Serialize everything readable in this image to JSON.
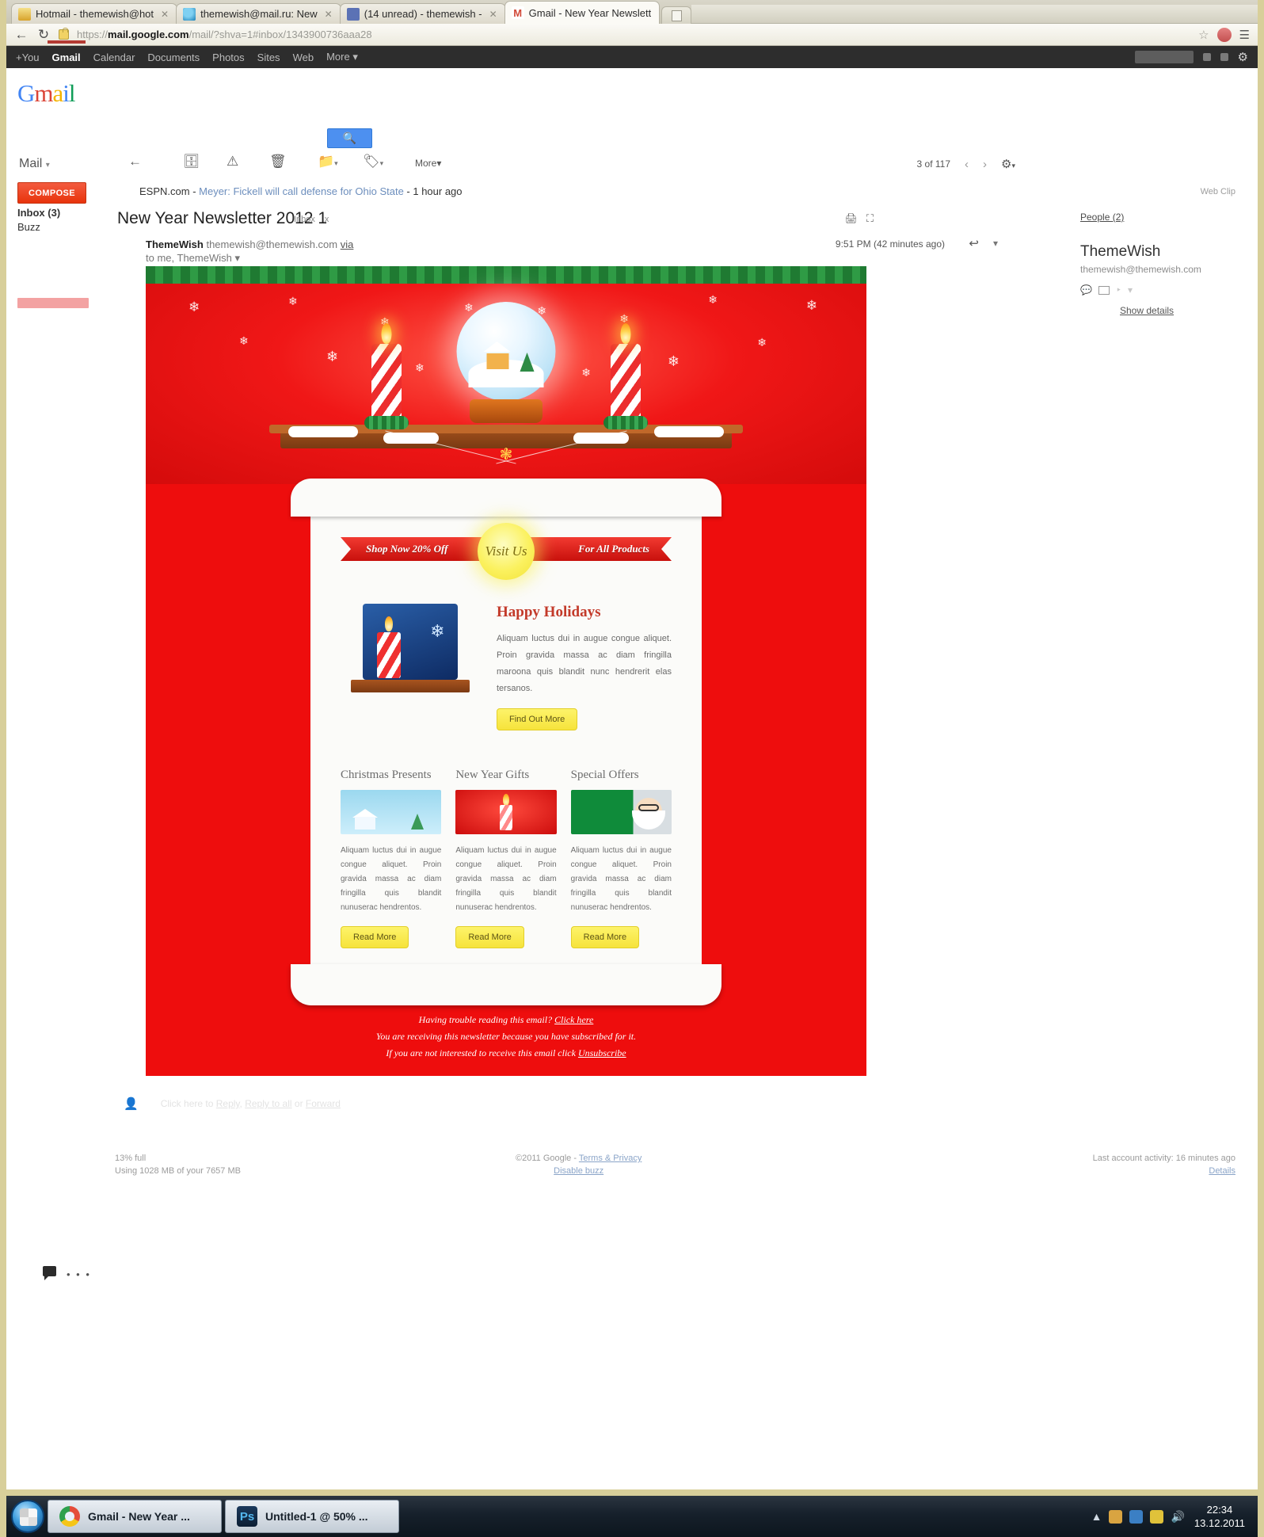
{
  "browser": {
    "tabs": [
      {
        "title": "Hotmail - themewish@hot",
        "favicon": "hotmail-icon",
        "active": false
      },
      {
        "title": "themewish@mail.ru: New",
        "favicon": "mailru-icon",
        "active": false
      },
      {
        "title": "(14 unread) - themewish -",
        "favicon": "facebook-icon",
        "active": false
      },
      {
        "title": "Gmail - New Year Newslett",
        "favicon": "gmail-icon",
        "active": true
      }
    ],
    "new_tab_label": "+",
    "back_icon": "back-arrow-icon",
    "reload_icon": "reload-icon",
    "lock_icon": "ssl-lock-icon",
    "url_scheme": "https://",
    "url_host": "mail.google.com",
    "url_path": "/mail/?shva=1#inbox/1343900736aaa28",
    "star_icon": "star-icon",
    "wrench_icon": "wrench-menu-icon"
  },
  "gbar": {
    "items": [
      "+You",
      "Gmail",
      "Calendar",
      "Documents",
      "Photos",
      "Sites",
      "Web",
      "More"
    ],
    "active": "Gmail",
    "more_caret": "▾",
    "gear_icon": "settings-gear-icon"
  },
  "gmail": {
    "logo": {
      "g": "G",
      "m": "m",
      "a": "a",
      "i": "i",
      "l": "l"
    },
    "mail_selector": "Mail",
    "mail_selector_caret": "▾",
    "compose_label": "COMPOSE",
    "nav": [
      {
        "label": "Inbox (3)",
        "bold": true
      },
      {
        "label": "Buzz",
        "bold": false
      }
    ],
    "search_icon": "search-magnifier-icon",
    "toolbar": {
      "back_icon": "back-to-inbox-icon",
      "archive_icon": "archive-icon",
      "spam_icon": "report-spam-icon",
      "delete_icon": "trash-delete-icon",
      "move_icon": "move-to-folder-icon",
      "label_icon": "labels-tag-icon",
      "more_label": "More",
      "caret": "▾"
    },
    "pager": {
      "text": "3 of 117",
      "prev_icon": "previous-arrow-icon",
      "next_icon": "next-arrow-icon",
      "gear_icon": "settings-gear-icon"
    },
    "web_clip_label": "Web Clip",
    "ad_strip": {
      "source": "ESPN.com",
      "headline": "Meyer: Fickell will call defense for Ohio State",
      "time": "1 hour ago"
    },
    "subject": "New Year Newsletter 2012 1",
    "subject_tags": [
      "Inbox",
      "x"
    ],
    "print_icon": "print-icon",
    "popout_icon": "open-in-new-window-icon",
    "sender": {
      "name": "ThemeWish",
      "email": "themewish@themewish.com",
      "via": "via",
      "recipients": "to me, ThemeWish",
      "caret": "▾"
    },
    "message_time": "9:51 PM (42 minutes ago)",
    "reply_icon": "reply-arrow-icon",
    "more_options_icon": "more-options-caret-icon",
    "people_panel": {
      "title": "People (2)",
      "contact_name": "ThemeWish",
      "contact_email": "themewish@themewish.com",
      "chat_icon": "chat-bubble-icon",
      "video_icon": "video-call-icon",
      "show_details": "Show details"
    },
    "reply_prompt": {
      "person_icon": "person-icon",
      "text": "Click here to",
      "reply": "Reply",
      "reply_all": "Reply to all",
      "forward": "Forward"
    },
    "footer": {
      "storage_percent": "13% full",
      "storage_usage": "Using 1028 MB of your 7657 MB",
      "copyright": "©2011 Google -",
      "terms": "Terms & Privacy",
      "disable_buzz": "Disable buzz",
      "last_activity": "Last account activity: 16 minutes ago",
      "details": "Details"
    },
    "chat_icon": "chat-status-icon",
    "chat_dots": "• • •"
  },
  "newsletter": {
    "hero": {
      "alt": "christmas-snow-globe-candles-hero"
    },
    "ribbon": {
      "left": "Shop Now 20% Off",
      "badge": "Visit Us",
      "right": "For All Products"
    },
    "feature": {
      "heading": "Happy Holidays",
      "body": "Aliquam luctus dui in augue congue aliquet. Proin gravida massa ac diam fringilla maroona quis blandit nunc hendrerit elas tersanos.",
      "button": "Find Out More",
      "image_alt": "blue-candle-snowflake-image"
    },
    "columns": [
      {
        "title": "Christmas Presents",
        "body": "Aliquam luctus dui in augue congue aliquet. Proin gravida massa ac diam fringilla quis blandit nunuserac hendrentos.",
        "button": "Read More",
        "image_alt": "snowy-house-thumbnail"
      },
      {
        "title": "New Year Gifts",
        "body": "Aliquam luctus dui in augue congue aliquet. Proin gravida massa ac diam fringilla quis blandit nunuserac hendrentos.",
        "button": "Read More",
        "image_alt": "red-candle-thumbnail"
      },
      {
        "title": "Special Offers",
        "body": "Aliquam luctus dui in augue congue aliquet. Proin gravida massa ac diam fringilla quis blandit nunuserac hendrentos.",
        "button": "Read More",
        "image_alt": "santa-claus-thumbnail"
      }
    ],
    "footer": {
      "line1_text": "Having trouble reading this email?",
      "line1_link": "Click here",
      "line2": "You are receiving this newsletter because you have subscribed for it.",
      "line3_text": "If you are not interested to receive this email click",
      "line3_link": "Unsubscribe"
    }
  },
  "taskbar": {
    "start_label": "start-orb",
    "tasks": [
      {
        "label": "Gmail - New Year ...",
        "icon": "chrome-icon"
      },
      {
        "label": "Untitled-1 @ 50% ...",
        "icon": "photoshop-icon"
      }
    ],
    "tray": [
      "show-hidden-icon",
      "safely-remove-icon",
      "network-icon",
      "action-center-icon",
      "volume-icon"
    ],
    "clock_time": "22:34",
    "clock_date": "13.12.2011"
  },
  "colors": {
    "accent_red": "#ee0d0d",
    "compose_red": "#e8340c",
    "gmail_blue": "#4d90f0",
    "link_blue": "#6c8ebd"
  }
}
